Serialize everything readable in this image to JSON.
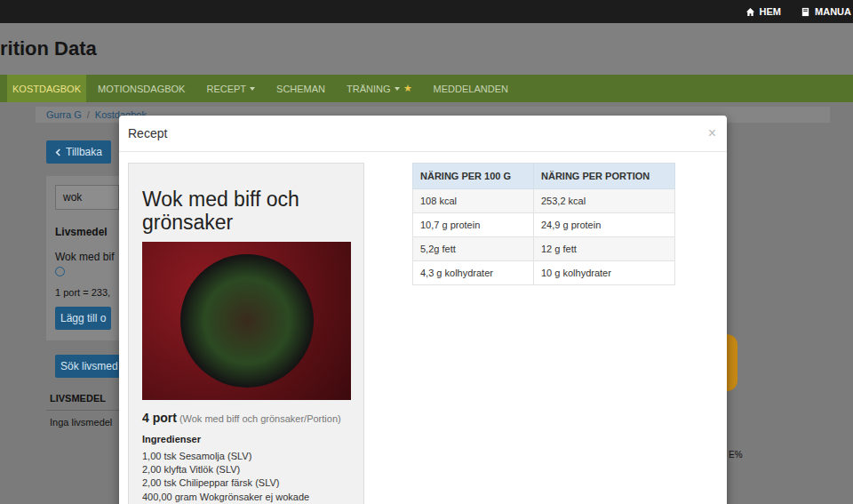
{
  "topbar": {
    "links": [
      "HEM",
      "MANUA"
    ]
  },
  "app_title": "rition Data",
  "nav": [
    {
      "label": "KOSTDAGBOK",
      "selected": true,
      "dropdown": false
    },
    {
      "label": "MOTIONSDAGBOK",
      "selected": false,
      "dropdown": false
    },
    {
      "label": "RECEPT",
      "selected": false,
      "dropdown": true
    },
    {
      "label": "SCHEMAN",
      "selected": false,
      "dropdown": false
    },
    {
      "label": "TRÄNING",
      "selected": false,
      "dropdown": true,
      "badge": "★"
    },
    {
      "label": "MEDDELANDEN",
      "selected": false,
      "dropdown": false
    }
  ],
  "breadcrumb": [
    "Gurra G",
    "Kostdagbok"
  ],
  "back_button": "Tillbaka",
  "search": {
    "value": "wok"
  },
  "results": {
    "header": "Livsmedel",
    "item": "Wok med bif",
    "portion": "1 port = 233,",
    "add_button": "Lägg till o"
  },
  "search_food_button": "Sök livsmed",
  "food_table": {
    "columns": [
      "LIVSMEDEL"
    ],
    "empty": "Inga livsmedel"
  },
  "side_reading": "E%",
  "modal": {
    "title": "Recept",
    "close": "×",
    "recipe": {
      "name": "Wok med biff och grönsaker",
      "portions": "4 port",
      "portion_note": "(Wok med biff och grönsaker/Portion)",
      "ingredients_title": "Ingredienser",
      "ingredients": [
        "1,00 tsk Sesamolja (SLV)",
        "2,00 klyfta Vitlök (SLV)",
        "2,00 tsk Chilipeppar färsk (SLV)",
        "400,00 gram Wokgrönsaker ej wokade"
      ]
    },
    "nutrition": {
      "columns": [
        "NÄRING PER 100 G",
        "NÄRING PER PORTION"
      ],
      "rows": [
        [
          "108 kcal",
          "253,2 kcal"
        ],
        [
          "10,7 g protein",
          "24,9 g protein"
        ],
        [
          "5,2g fett",
          "12 g fett"
        ],
        [
          "4,3 g kolhydrater",
          "10 g kolhydrater"
        ]
      ]
    }
  }
}
